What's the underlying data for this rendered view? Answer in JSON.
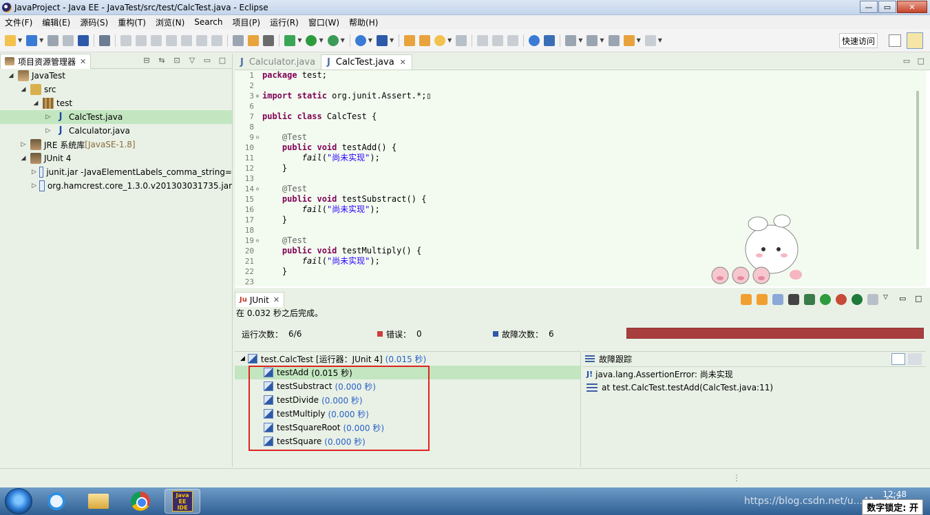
{
  "window": {
    "title": "JavaProject  -  Java EE  -  JavaTest/src/test/CalcTest.java  -  Eclipse",
    "controls": {
      "minimize": "—",
      "maximize": "▭",
      "close": "✕"
    }
  },
  "menu": [
    "文件(F)",
    "编辑(E)",
    "源码(S)",
    "重构(T)",
    "浏览(N)",
    "Search",
    "项目(P)",
    "运行(R)",
    "窗口(W)",
    "帮助(H)"
  ],
  "toolbar": {
    "quick_access": "快速访问"
  },
  "package_explorer": {
    "tab_label": "项目资源管理器",
    "tree": [
      {
        "label": "JavaTest",
        "suffix": "",
        "indent": 1,
        "twisty": "◢",
        "icon": "project"
      },
      {
        "label": "src",
        "suffix": "",
        "indent": 2,
        "twisty": "◢",
        "icon": "srcfolder"
      },
      {
        "label": "test",
        "suffix": "",
        "indent": 3,
        "twisty": "◢",
        "icon": "pkg"
      },
      {
        "label": "CalcTest.java",
        "suffix": "",
        "indent": 4,
        "twisty": "▷",
        "icon": "jfile",
        "selected": true
      },
      {
        "label": "Calculator.java",
        "suffix": "",
        "indent": 4,
        "twisty": "▷",
        "icon": "jfile"
      },
      {
        "label": "JRE 系统库 ",
        "suffix": "[JavaSE-1.8]",
        "indent": 2,
        "twisty": "▷",
        "icon": "lib"
      },
      {
        "label": "JUnit 4",
        "suffix": "",
        "indent": 2,
        "twisty": "◢",
        "icon": "lib"
      },
      {
        "label": "junit.jar -JavaElementLabels_comma_string=",
        "suffix": "",
        "indent": 3,
        "twisty": "▷",
        "icon": "jar"
      },
      {
        "label": "org.hamcrest.core_1.3.0.v201303031735.jar",
        "suffix": "",
        "indent": 3,
        "twisty": "▷",
        "icon": "jar"
      }
    ]
  },
  "editor": {
    "tabs": [
      {
        "label": "Calculator.java",
        "active": false
      },
      {
        "label": "CalcTest.java",
        "active": true
      }
    ],
    "lines": [
      {
        "n": "1",
        "fold": "",
        "html": "<span class='kw'>package</span> test;"
      },
      {
        "n": "2",
        "fold": "",
        "html": ""
      },
      {
        "n": "3",
        "fold": "⊕",
        "html": "<span class='kw'>import static</span> org.junit.Assert.*;▯"
      },
      {
        "n": "6",
        "fold": "",
        "html": ""
      },
      {
        "n": "7",
        "fold": "",
        "html": "<span class='kw'>public class</span> CalcTest {"
      },
      {
        "n": "8",
        "fold": "",
        "html": ""
      },
      {
        "n": "9",
        "fold": "⊖",
        "html": "    <span class='ann'>@Test</span>"
      },
      {
        "n": "10",
        "fold": "",
        "html": "    <span class='kw'>public void</span> testAdd() {"
      },
      {
        "n": "11",
        "fold": "",
        "html": "        <span class='it'>fail</span>(<span class='str'>\"尚未实现\"</span>);"
      },
      {
        "n": "12",
        "fold": "",
        "html": "    }"
      },
      {
        "n": "13",
        "fold": "",
        "html": ""
      },
      {
        "n": "14",
        "fold": "⊖",
        "html": "    <span class='ann'>@Test</span>"
      },
      {
        "n": "15",
        "fold": "",
        "html": "    <span class='kw'>public void</span> testSubstract() {"
      },
      {
        "n": "16",
        "fold": "",
        "html": "        <span class='it'>fail</span>(<span class='str'>\"尚未实现\"</span>);"
      },
      {
        "n": "17",
        "fold": "",
        "html": "    }"
      },
      {
        "n": "18",
        "fold": "",
        "html": ""
      },
      {
        "n": "19",
        "fold": "⊖",
        "html": "    <span class='ann'>@Test</span>"
      },
      {
        "n": "20",
        "fold": "",
        "html": "    <span class='kw'>public void</span> testMultiply() {"
      },
      {
        "n": "21",
        "fold": "",
        "html": "        <span class='it'>fail</span>(<span class='str'>\"尚未实现\"</span>);"
      },
      {
        "n": "22",
        "fold": "",
        "html": "    }"
      },
      {
        "n": "23",
        "fold": "",
        "html": ""
      }
    ]
  },
  "junit": {
    "tab_label": "JUnit",
    "status_message": "在 0.032 秒之后完成。",
    "runs_label": "运行次数：",
    "runs_value": "6/6",
    "errors_label": "错误：",
    "errors_value": "0",
    "failures_label": "故障次数：",
    "failures_value": "6",
    "root": {
      "label": "test.CalcTest [运行器：JUnit 4]",
      "time": "(0.015 秒)"
    },
    "tests": [
      {
        "name": "testAdd",
        "time": "(0.015 秒)",
        "selected": true
      },
      {
        "name": "testSubstract",
        "time": "(0.000 秒)"
      },
      {
        "name": "testDivide",
        "time": "(0.000 秒)"
      },
      {
        "name": "testMultiply",
        "time": "(0.000 秒)"
      },
      {
        "name": "testSquareRoot",
        "time": "(0.000 秒)"
      },
      {
        "name": "testSquare",
        "time": "(0.000 秒)"
      }
    ],
    "failure_trace_label": "故障跟踪",
    "trace_lines": [
      "java.lang.AssertionError: 尚未实现",
      "at test.CalcTest.testAdd(CalcTest.java:11)"
    ]
  },
  "taskbar": {
    "eclipse_label": "Java EE IDE",
    "clock": "12:48",
    "watermark": "https://blog.csdn.net/u...41...425",
    "numlock": "数字锁定: 开"
  }
}
